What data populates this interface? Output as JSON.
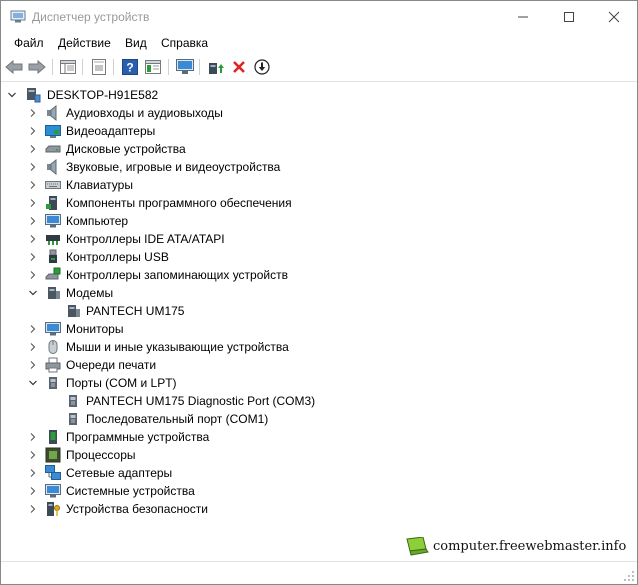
{
  "window": {
    "title": "Диспетчер устройств",
    "controls": [
      "minimize-icon",
      "maximize-icon",
      "close-icon"
    ]
  },
  "menu": {
    "items": [
      "Файл",
      "Действие",
      "Вид",
      "Справка"
    ]
  },
  "toolbar": {
    "icons": [
      "back-arrow-icon",
      "forward-arrow-icon",
      "show-hide-tree-icon",
      "properties-icon",
      "help-icon",
      "details-view-icon",
      "scan-hardware-icon",
      "update-driver-icon",
      "uninstall-device-icon",
      "disable-device-icon"
    ],
    "colors": {
      "delete": "#e02424",
      "accent_green": "#2e9b3a",
      "accent_blue": "#2a6db3"
    }
  },
  "tree": {
    "root": "DESKTOP-H91E582",
    "categories": [
      {
        "label": "Аудиовходы и аудиовыходы",
        "icon": "speaker-icon",
        "expanded": false
      },
      {
        "label": "Видеоадаптеры",
        "icon": "display-adapter-icon",
        "expanded": false
      },
      {
        "label": "Дисковые устройства",
        "icon": "disk-drive-icon",
        "expanded": false
      },
      {
        "label": "Звуковые, игровые и видеоустройства",
        "icon": "speaker-icon",
        "expanded": false
      },
      {
        "label": "Клавиатуры",
        "icon": "keyboard-icon",
        "expanded": false
      },
      {
        "label": "Компоненты программного обеспечения",
        "icon": "software-component-icon",
        "expanded": false
      },
      {
        "label": "Компьютер",
        "icon": "monitor-icon",
        "expanded": false
      },
      {
        "label": "Контроллеры IDE ATA/ATAPI",
        "icon": "ide-controller-icon",
        "expanded": false
      },
      {
        "label": "Контроллеры USB",
        "icon": "usb-icon",
        "expanded": false
      },
      {
        "label": "Контроллеры запоминающих устройств",
        "icon": "storage-controller-icon",
        "expanded": false
      },
      {
        "label": "Модемы",
        "icon": "modem-icon",
        "expanded": true,
        "children": [
          {
            "label": "PANTECH UM175",
            "icon": "modem-icon"
          }
        ]
      },
      {
        "label": "Мониторы",
        "icon": "monitor-icon",
        "expanded": false
      },
      {
        "label": "Мыши и иные указывающие устройства",
        "icon": "mouse-icon",
        "expanded": false
      },
      {
        "label": "Очереди печати",
        "icon": "printer-icon",
        "expanded": false
      },
      {
        "label": "Порты (COM и LPT)",
        "icon": "port-icon",
        "expanded": true,
        "children": [
          {
            "label": "PANTECH UM175 Diagnostic Port (COM3)",
            "icon": "port-icon"
          },
          {
            "label": "Последовательный порт (COM1)",
            "icon": "port-icon"
          }
        ]
      },
      {
        "label": "Программные устройства",
        "icon": "software-device-icon",
        "expanded": false
      },
      {
        "label": "Процессоры",
        "icon": "processor-icon",
        "expanded": false
      },
      {
        "label": "Сетевые адаптеры",
        "icon": "network-adapter-icon",
        "expanded": false
      },
      {
        "label": "Системные устройства",
        "icon": "system-device-icon",
        "expanded": false
      },
      {
        "label": "Устройства безопасности",
        "icon": "security-device-icon",
        "expanded": false
      }
    ]
  },
  "watermark": {
    "text": "computer.freewebmaster.info",
    "icon": "laptop-icon"
  }
}
